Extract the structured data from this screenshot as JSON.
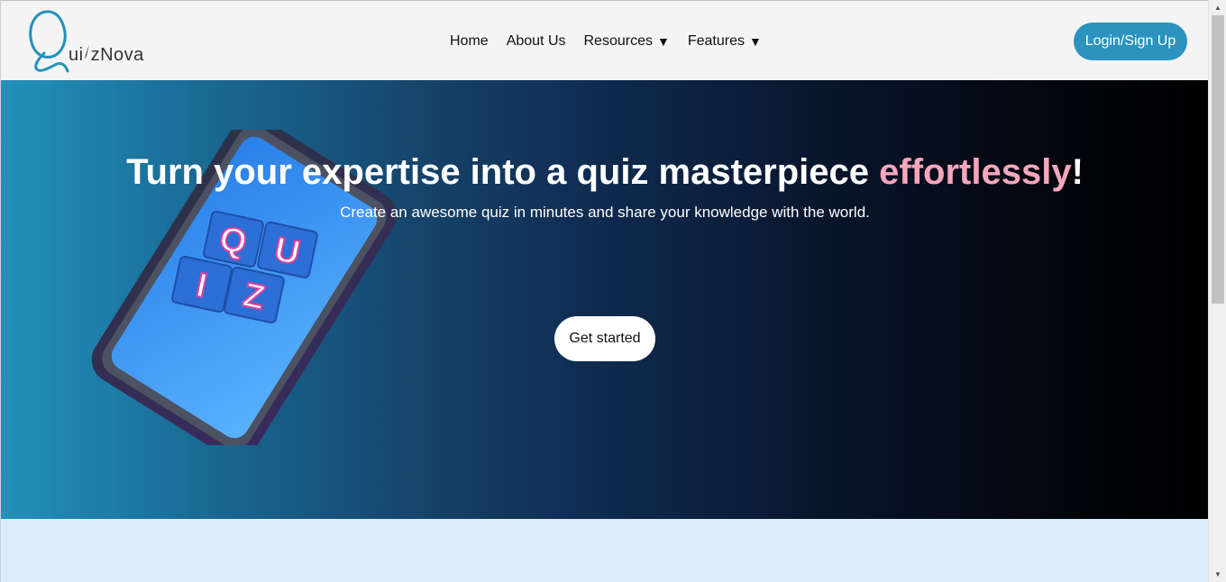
{
  "header": {
    "logo": {
      "letter": "Q",
      "text_before": "ui",
      "text_after": "zNova"
    },
    "nav": [
      {
        "label": "Home",
        "dropdown": false
      },
      {
        "label": "About Us",
        "dropdown": false
      },
      {
        "label": "Resources",
        "dropdown": true
      },
      {
        "label": "Features",
        "dropdown": true
      }
    ],
    "caret": "▼",
    "login_label": "Login/Sign Up"
  },
  "hero": {
    "title_main": "Turn your expertise into a quiz masterpiece ",
    "title_accent": "effortlessly",
    "title_end": "!",
    "subtitle": "Create an awesome quiz in minutes and share your knowledge with the world.",
    "cta_label": "Get started",
    "tiles": [
      "Q",
      "U",
      "I",
      "Z"
    ]
  },
  "colors": {
    "brand": "#2b93bd",
    "accent": "#f7a6bc",
    "header_bg": "#f4f4f4",
    "lower_bg": "#dcedfa"
  },
  "scrollbar": {
    "up": "▲",
    "down": "▼"
  }
}
